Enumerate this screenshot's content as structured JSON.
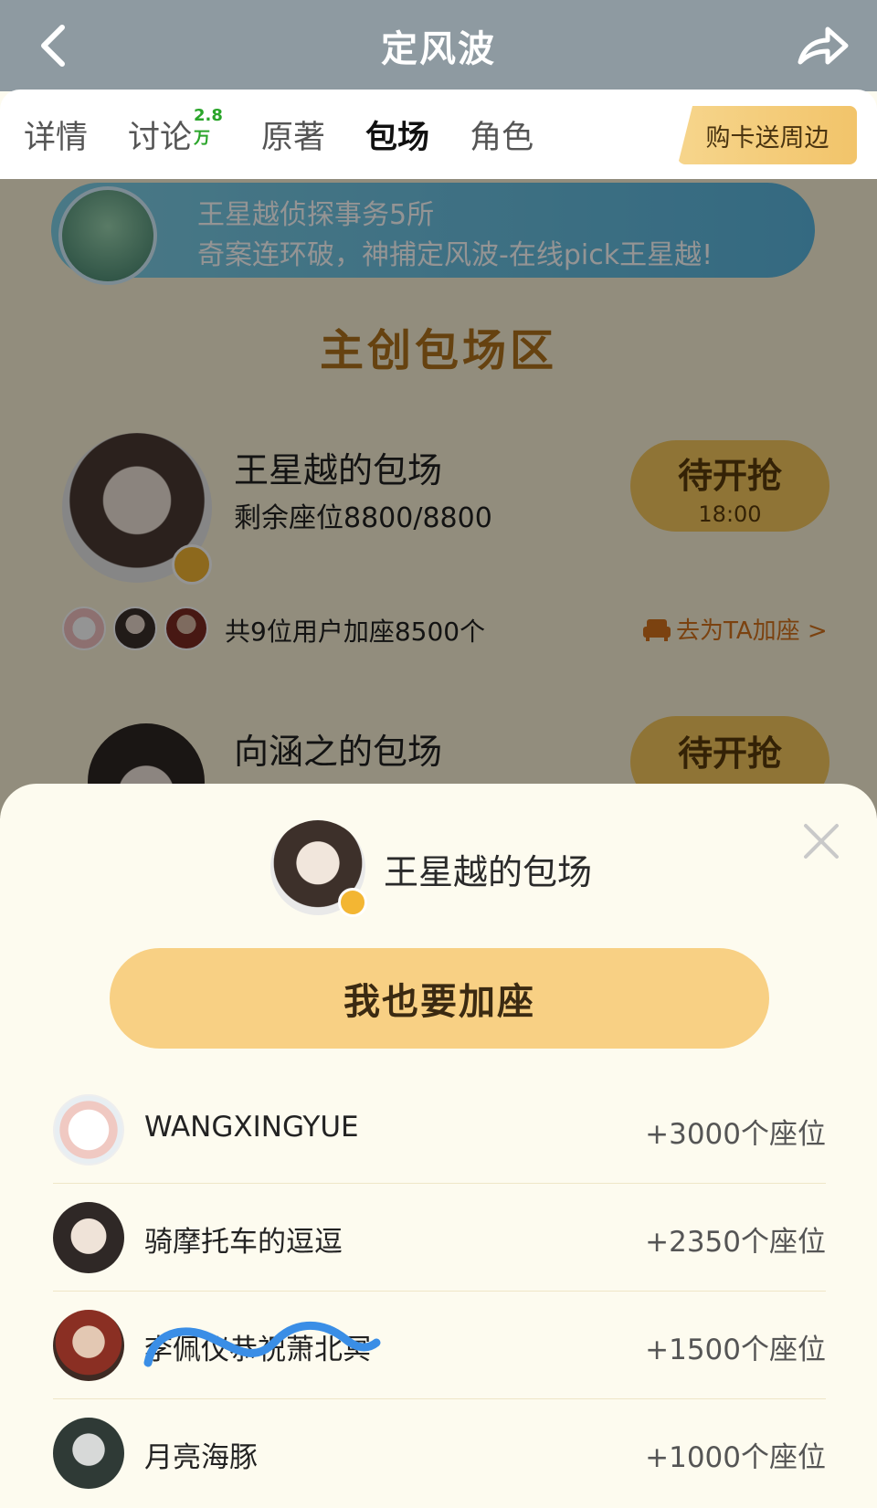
{
  "header": {
    "title": "定风波"
  },
  "tabs": [
    {
      "label": "详情"
    },
    {
      "label": "讨论",
      "badge": "2.8万"
    },
    {
      "label": "原著"
    },
    {
      "label": "包场",
      "active": true
    },
    {
      "label": "角色"
    }
  ],
  "promo": {
    "label": "购卡送周边"
  },
  "banner": {
    "line1": "王星越侦探事务5所",
    "line2": "奇案连环破，神捕定风波-在线pick王星越!"
  },
  "section": {
    "title": "主创包场区"
  },
  "card": {
    "name": "王星越的包场",
    "seats": "剩余座位8800/8800",
    "button_main": "待开抢",
    "button_time": "18:00",
    "add_count": "共9位用户加座8500个",
    "add_link": "去为TA加座 >"
  },
  "card2": {
    "name": "向涵之的包场",
    "button_main": "待开抢"
  },
  "sheet": {
    "title": "王星越的包场",
    "join_button": "我也要加座",
    "rows": [
      {
        "name": "WANGXINGYUE",
        "seats": "+3000个座位"
      },
      {
        "name": "骑摩托车的逗逗",
        "seats": "+2350个座位"
      },
      {
        "name": "李佩仪恭祝萧北冥",
        "seats": "+1500个座位"
      },
      {
        "name": "月亮海豚",
        "seats": "+1000个座位"
      }
    ]
  },
  "colors": {
    "topbar": "#8e9aa1",
    "accent": "#f8d084",
    "section_title": "#b0721c",
    "scribble": "#3a8ee6"
  }
}
